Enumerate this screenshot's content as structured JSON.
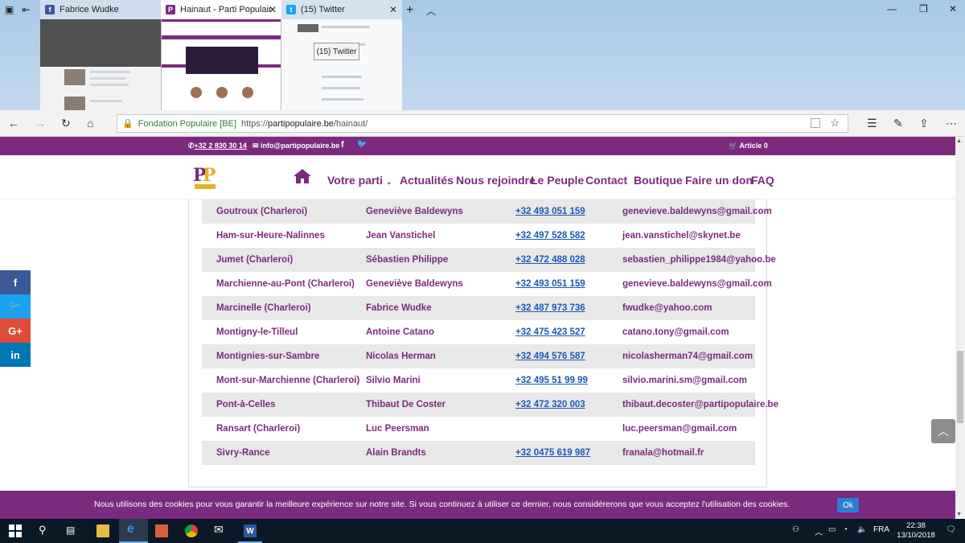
{
  "browser": {
    "tabs": [
      {
        "label": "Fabrice Wudke"
      },
      {
        "label": "Hainaut - Parti Populair"
      },
      {
        "label": "(15) Twitter"
      }
    ],
    "tooltip": "(15) Twitter",
    "address": {
      "org": "Fondation Populaire [BE]",
      "url_prefix": "https://",
      "url_domain": "partipopulaire.be",
      "url_path": "/hainaut/"
    }
  },
  "site": {
    "topbar": {
      "phone": "+32 2 830 30 14",
      "email": "info@partipopulaire.be",
      "cart": "Article 0"
    },
    "menu": [
      "Votre parti",
      "Actualités",
      "Nous rejoindre",
      "Le Peuple",
      "Contact",
      "Boutique",
      "Faire un don",
      "FAQ"
    ],
    "table_rows": [
      [
        "Goutroux (Charleroi)",
        "Geneviève Baldewyns",
        "+32 493 051 159",
        "genevieve.baldewyns@gmail.com"
      ],
      [
        "Ham-sur-Heure-Nalinnes",
        "Jean Vanstichel",
        "+32 497 528 582",
        "jean.vanstichel@skynet.be"
      ],
      [
        "Jumet (Charleroi)",
        "Sébastien Philippe",
        "+32 472 488 028",
        "sebastien_philippe1984@yahoo.be"
      ],
      [
        "Marchienne-au-Pont (Charleroi)",
        "Geneviève Baldewyns",
        "+32 493 051 159",
        "genevieve.baldewyns@gmail.com"
      ],
      [
        "Marcinelle (Charleroi)",
        "Fabrice Wudke",
        "+32 487 973 736",
        "fwudke@yahoo.com"
      ],
      [
        "Montigny-le-Tilleul",
        "Antoine Catano",
        "+32 475 423 527",
        "catano.tony@gmail.com"
      ],
      [
        "Montignies-sur-Sambre",
        "Nicolas Herman",
        "+32 494 576 587",
        "nicolasherman74@gmail.com"
      ],
      [
        "Mont-sur-Marchienne (Charleroi)",
        "Silvio Marini",
        "+32 495 51 99 99",
        "silvio.marini.sm@gmail.com"
      ],
      [
        "Pont-à-Celles",
        "Thibaut De Coster",
        "+32 472 320 003",
        "thibaut.decoster@partipopulaire.be"
      ],
      [
        "Ransart (Charleroi)",
        "Luc Peersman",
        "",
        "luc.peersman@gmail.com"
      ],
      [
        "Sivry-Rance",
        "Alain Brandts",
        "+32 0475 619 987",
        "franala@hotmail.fr"
      ]
    ],
    "social": [
      {
        "label": "f",
        "color": "#3b5998"
      },
      {
        "label": "🐦",
        "color": "#1da1f2"
      },
      {
        "label": "G+",
        "color": "#dd4b39"
      },
      {
        "label": "in",
        "color": "#0077b5"
      }
    ],
    "cookie": {
      "text": "Nous utilisons des cookies pour vous garantir la meilleure expérience sur notre site. Si vous continuez à utiliser ce dernier, nous considérerons que vous acceptez l'utilisation des cookies.",
      "ok": "Ok"
    }
  },
  "taskbar": {
    "lang": "FRA",
    "time": "22:38",
    "date": "13/10/2018"
  },
  "colors": {
    "brand": "#7b2b7e",
    "link": "#1a5ab5"
  }
}
